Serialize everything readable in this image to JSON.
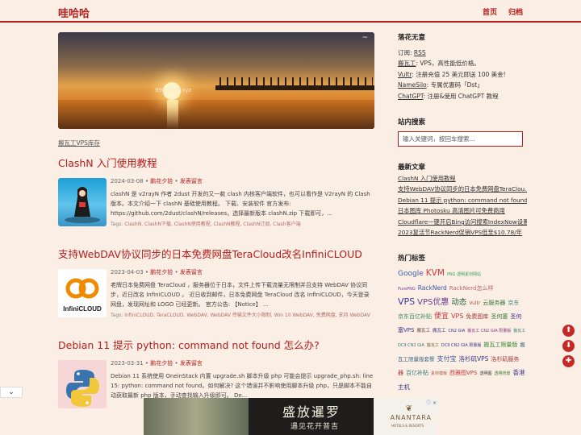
{
  "header": {
    "logo": "哇哈哈",
    "nav": [
      "首页",
      "归档"
    ]
  },
  "banner": {
    "watermark": "9987688.xyz",
    "corner": "~"
  },
  "banner_caption": "搬瓦工VPS库存",
  "posts": [
    {
      "title": "ClashN 入门使用教程",
      "date": "2024-03-08",
      "author": "鹏花夕拾",
      "comment": "发表留言",
      "excerpt": "clashN 是 v2rayN 作者 2dust 开发的又一款 clash 内核客户端软件，也可以看作是 V2rayN 的 Clash 版本。本文介绍一下 clashN 基础使用教程。 下载、安装软件 官方发布: https://github.com/2dust/clashN/releases，选择最新版本 clashN.zip 下载即可，...",
      "tags": [
        "ClashN",
        "ClashN下载",
        "ClashN使用教程",
        "ClashN教程",
        "ClashN订阅",
        "Clash客户端"
      ]
    },
    {
      "title": "支持WebDAV协议同步的日本免费网盘TeraCloud改名InfiniCLOUD",
      "date": "2023-04-03",
      "author": "鹏花夕拾",
      "comment": "发表留言",
      "excerpt": "老牌日本免费网盘 TeraCloud ，服务器位于日本，文件上传下载流量无限制并且支持 WebDAV 协议同步，近日改名 InfiniCLOUD 。 近日收到邮件，日本免费网盘 TeraCloud 改名 InfiniCLOUD，今天登录网盘，发现网址和 LOGO 已经更新。 官方公告: 【Notice】 ...",
      "tags": [
        "InfiniCLOUD",
        "TeraCLOUD",
        "WebDAV",
        "WebDAV 传输文件大小限制",
        "Win 10 WebDAV",
        "免费网盘",
        "支持 WebDAV"
      ],
      "thumb_text": "InfiniCLOUD"
    },
    {
      "title": "Debian 11 提示 python: command not found 怎么办?",
      "date": "2023-03-31",
      "author": "鹏花夕拾",
      "comment": "发表留言",
      "excerpt": "Debian 11 系统使用 OneinStack 内置 upgrade.sh 脚本升级 php 可能会提示 upgrade_php.sh: line 15: python: command not found。如何解决? 这个错误并不影响使用脚本升级 php，只是脚本不能自动获取最新 php 版本，手动查找输入升级即可。 De...",
      "tags": []
    }
  ],
  "tags_label": "Tags:",
  "meta_sep": "•",
  "sidebar": {
    "about_title": "落花无意",
    "about_lines": [
      {
        "pre": "订阅: ",
        "link": "RSS",
        "post": ""
      },
      {
        "pre": "",
        "link": "搬瓦工",
        "post": ": VPS，高性能低价格。"
      },
      {
        "pre": "",
        "link": "Vultr",
        "post": ": 注册充值 25 美元即送 100 美金!"
      },
      {
        "pre": "",
        "link": "NameSilo",
        "post": ": 专属优惠码「Dst」"
      },
      {
        "pre": "",
        "link": "ChatGPT",
        "post": ": 注册&使用 ChatGPT 教程"
      }
    ],
    "search_title": "站内搜索",
    "search_placeholder": "输入关键词，按回车搜索...",
    "recent_title": "最新文章",
    "recent": [
      "ClashN 入门使用教程",
      "支持WebDAV协议同步的日本免费网盘TeraClou...",
      "Debian 11 提示 python: command not found 怎...",
      "日本图库 Photosku 高清图片可免费商用",
      "Cloudflare一键开启Bing访问搜索IndexNow设置...",
      "2023复活节RackNerd促销VPS低至$10.78/年"
    ],
    "tags_title": "热门标签",
    "tag_cloud": [
      {
        "t": "Google",
        "c": "#3b5ea8",
        "s": 9
      },
      {
        "t": "KVM",
        "c": "#c73a3a",
        "s": 10.5
      },
      {
        "t": "PNG 透明素材网站",
        "c": "#3aa35a",
        "s": 5
      },
      {
        "t": "PurePNG",
        "c": "#7a3aa3",
        "s": 5
      },
      {
        "t": "RackNerd",
        "c": "#3a5aa3",
        "s": 7.5
      },
      {
        "t": "RackNerd怎么样",
        "c": "#b56a6a",
        "s": 7
      },
      {
        "t": "VPS",
        "c": "#3a3aa3",
        "s": 11
      },
      {
        "t": "VPS优惠",
        "c": "#6a3a8a",
        "s": 10
      },
      {
        "t": "动态",
        "c": "#1e5e3a",
        "s": 9.5
      },
      {
        "t": "Vultr",
        "c": "#a35a3a",
        "s": 6
      },
      {
        "t": "云服务器",
        "c": "#3a7a3a",
        "s": 7
      },
      {
        "t": "京东",
        "c": "#3a8a8a",
        "s": 7
      },
      {
        "t": "京东百亿补贴",
        "c": "#3a8a5a",
        "s": 7
      },
      {
        "t": "便宜",
        "c": "#c73a3a",
        "s": 9
      },
      {
        "t": "VPS",
        "c": "#c73a3a",
        "s": 8
      },
      {
        "t": "免费图库",
        "c": "#a33a3a",
        "s": 7
      },
      {
        "t": "圣何塞",
        "c": "#3a7a3a",
        "s": 7
      },
      {
        "t": "圣何塞VPS",
        "c": "#3a3a8a",
        "s": 7
      },
      {
        "t": "搬瓦工",
        "c": "#6a3a3a",
        "s": 5.5
      },
      {
        "t": "搬瓦工",
        "c": "#3a3a8a",
        "s": 5.5
      },
      {
        "t": "CN2 GIA",
        "c": "#3a3a8a",
        "s": 5
      },
      {
        "t": "搬瓦工 CN2 GIA 限量版",
        "c": "#8a3a8a",
        "s": 5
      },
      {
        "t": "搬瓦工 DC9 CN2 GIA",
        "c": "#3a7a7a",
        "s": 5
      },
      {
        "t": "搬瓦工",
        "c": "#6a6a3a",
        "s": 5
      },
      {
        "t": "DC9 CN2 GIA 限量版",
        "c": "#3a3a8a",
        "s": 5
      },
      {
        "t": "搬瓦工限量版",
        "c": "#3a8a3a",
        "s": 7
      },
      {
        "t": "搬瓦工限量版套餐",
        "c": "#3a6a8a",
        "s": 6.5
      },
      {
        "t": "支付宝",
        "c": "#3a5aa3",
        "s": 8
      },
      {
        "t": "洛杉矶VPS",
        "c": "#3a3a8a",
        "s": 7.5
      },
      {
        "t": "洛杉矶服务器",
        "c": "#a33a3a",
        "s": 7
      },
      {
        "t": "百亿补贴",
        "c": "#3a7a7a",
        "s": 7
      },
      {
        "t": "素材模板",
        "c": "#a35a3a",
        "s": 5
      },
      {
        "t": "西雅图VPS",
        "c": "#c73a3a",
        "s": 7
      },
      {
        "t": "透明图",
        "c": "#3a3a3a",
        "s": 5
      },
      {
        "t": "透明背景",
        "c": "#3a7a3a",
        "s": 5
      },
      {
        "t": "香港主机",
        "c": "#3a3a8a",
        "s": 7.5
      }
    ]
  },
  "fab": {
    "top": "⬆",
    "down": "⬇",
    "comment": "✚"
  },
  "collapse_label": "⌄",
  "ad": {
    "big": "盛放暹罗",
    "small": "遇见花开普吉",
    "brand": "ANANTARA",
    "sub": "HOTELS & RESORTS",
    "x": "ⓘ ✕"
  }
}
